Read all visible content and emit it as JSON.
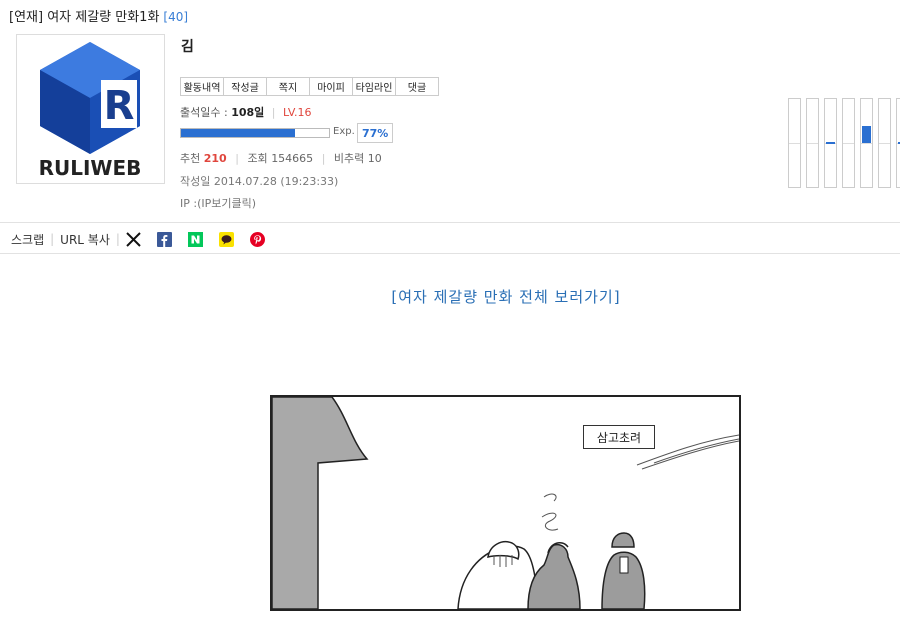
{
  "header": {
    "title": "[연재] 여자 제갈량 만화1화",
    "comment_count": "[40]"
  },
  "profile": {
    "logo_text": "RULIWEB",
    "logo_letter": "R",
    "username": "김",
    "menu_buttons": [
      "활동내역",
      "작성글",
      "쪽지",
      "마이피",
      "타임라인",
      "댓글"
    ],
    "attendance_label": "출석일수 :",
    "attendance_days": "108일",
    "level": "LV.16",
    "exp_label": "Exp.",
    "exp_percent": "77%",
    "exp_value": 0.77,
    "stats": {
      "recommend_label": "추천",
      "recommend_value": "210",
      "views_label": "조회",
      "views_value": "154665",
      "ratio_label": "비추력",
      "ratio_value": "10"
    },
    "date_label": "작성일",
    "date_value": "2014.07.28 (19:23:33)",
    "ip_label": "IP :",
    "ip_value": "(IP보기클릭)"
  },
  "share": {
    "scrap_label": "스크랩",
    "url_copy_label": "URL 복사",
    "icons": [
      "x-icon",
      "facebook-icon",
      "naver-icon",
      "kakaotalk-icon",
      "pinterest-icon"
    ],
    "colors": {
      "facebook": "#3b5998",
      "naver": "#03c75a",
      "kakao": "#fae100",
      "pinterest": "#e60023"
    }
  },
  "content": {
    "link_text": "[여자 제갈량 만화 전체 보러가기]",
    "comic_sign": "삼고초려"
  },
  "colors": {
    "accent": "#2a6fd1",
    "level_red": "#e0463d",
    "link_blue": "#2a6fb5"
  }
}
